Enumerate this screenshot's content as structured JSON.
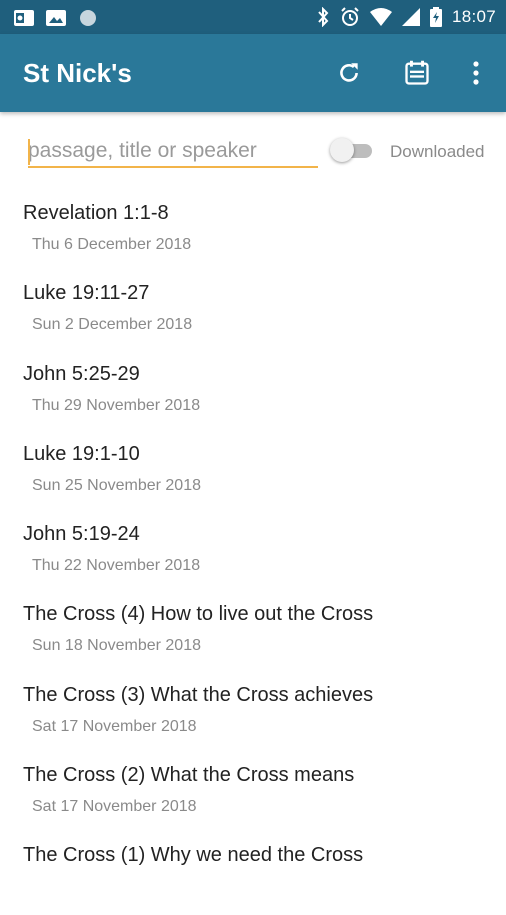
{
  "status_bar": {
    "time": "18:07",
    "left_icons": [
      "outlook-icon",
      "gallery-icon",
      "circle-icon"
    ],
    "right_icons": [
      "bluetooth-icon",
      "alarm-icon",
      "wifi-icon",
      "signal-icon",
      "battery-icon"
    ]
  },
  "app_bar": {
    "title": "St Nick's",
    "actions": [
      "refresh-icon",
      "calendar-icon",
      "overflow-menu-icon"
    ],
    "colors": {
      "status_bar": "#1f5f7d",
      "app_bar": "#2a7899",
      "accent": "#f2b44a"
    }
  },
  "search": {
    "placeholder": "passage, title or speaker",
    "value": ""
  },
  "filter": {
    "label": "Downloaded",
    "enabled": false
  },
  "sermons": [
    {
      "title": "Revelation 1:1-8",
      "date": "Thu 6 December 2018"
    },
    {
      "title": "Luke 19:11-27",
      "date": "Sun 2 December 2018"
    },
    {
      "title": "John 5:25-29",
      "date": "Thu 29 November 2018"
    },
    {
      "title": "Luke 19:1-10",
      "date": "Sun 25 November 2018"
    },
    {
      "title": "John 5:19-24",
      "date": "Thu 22 November 2018"
    },
    {
      "title": "The Cross (4) How to live out the Cross",
      "date": "Sun 18 November 2018"
    },
    {
      "title": "The Cross (3) What the Cross achieves",
      "date": "Sat 17 November 2018"
    },
    {
      "title": "The Cross (2) What the Cross means",
      "date": "Sat 17 November 2018"
    },
    {
      "title": "The Cross (1) Why we need the Cross",
      "date": ""
    }
  ]
}
